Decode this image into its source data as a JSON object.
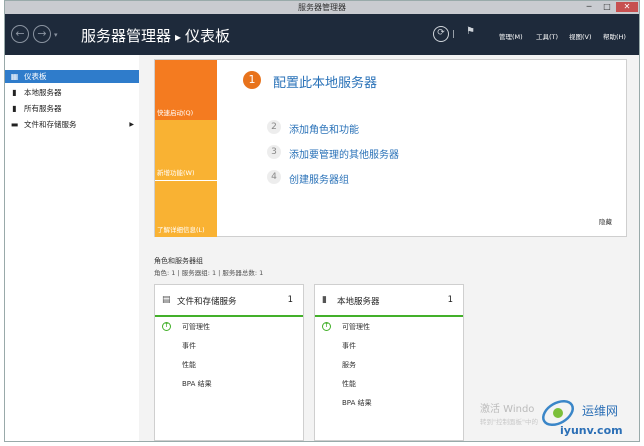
{
  "window": {
    "title": "服务器管理器",
    "min": "─",
    "max": "□",
    "close": "✕"
  },
  "nav": {
    "back_icon": "back-arrow-icon",
    "forward_icon": "forward-arrow-icon",
    "dropdown": "▾",
    "title": "服务器管理器",
    "separator": "▸",
    "page": "仪表板",
    "refresh_icon": "refresh-icon",
    "menus": [
      "管理(M)",
      "工具(T)",
      "视图(V)",
      "帮助(H)"
    ]
  },
  "sidebar": {
    "items": [
      {
        "label": "仪表板",
        "icon": "dashboard-icon",
        "active": true
      },
      {
        "label": "本地服务器",
        "icon": "server-icon"
      },
      {
        "label": "所有服务器",
        "icon": "servers-icon"
      },
      {
        "label": "文件和存储服务",
        "icon": "storage-icon",
        "arrow": "▶"
      }
    ]
  },
  "quickstart": {
    "sections": [
      "快速启动(Q)",
      "新增功能(W)",
      "了解详细信息(L)"
    ],
    "step1_num": "1",
    "step1": "配置此本地服务器",
    "steps": [
      {
        "num": "2",
        "label": "添加角色和功能"
      },
      {
        "num": "3",
        "label": "添加要管理的其他服务器"
      },
      {
        "num": "4",
        "label": "创建服务器组"
      }
    ],
    "hide": "隐藏"
  },
  "roles": {
    "title": "角色和服务器组",
    "summary": "角色: 1 | 服务器组: 1 | 服务器总数: 1",
    "tiles": [
      {
        "name": "文件和存储服务",
        "count": "1",
        "rows": [
          "可管理性",
          "事件",
          "性能",
          "BPA 结果"
        ]
      },
      {
        "name": "本地服务器",
        "count": "1",
        "rows": [
          "可管理性",
          "事件",
          "服务",
          "性能",
          "BPA 结果"
        ]
      }
    ]
  },
  "watermark": {
    "activate": "激活 Windo",
    "activate_sub": "转到\"控制面板\"中的",
    "site_cn": "运维网",
    "site": "iyunv.com"
  },
  "colors": {
    "nav_bg": "#1e2a3b",
    "accent_blue": "#2f7ccb",
    "orange": "#f47b20",
    "amber": "#f9b233",
    "ok_green": "#43b02a"
  }
}
